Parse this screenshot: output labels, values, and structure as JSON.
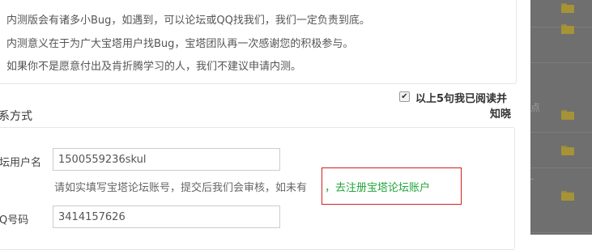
{
  "notice": {
    "lines": [
      "内测版会有诸多小Bug，如遇到，可以论坛或QQ找我们，我们一定负责到底。",
      "内测意义在于为广大宝塔用户找Bug，宝塔团队再一次感谢您的积极参与。",
      "如果你不是愿意付出及肯折腾学习的人，我们不建议申请内测。"
    ]
  },
  "agree": {
    "line1": "以上5句我已阅读并",
    "line2": "知晓",
    "checked": true
  },
  "contact": {
    "title": "系方式",
    "forum_label": "坛用户名",
    "forum_value": "1500559236skul",
    "forum_hint": "请如实填写宝塔论坛账号，提交后我们会审核，如未有",
    "register_link": "，去注册宝塔论坛账户",
    "qq_label": "Q号码",
    "qq_value": "3414157626"
  },
  "backdrop": {
    "glyph_a": "点",
    "glyph_b": "-",
    "folder_icon": "folder-open-icon"
  }
}
